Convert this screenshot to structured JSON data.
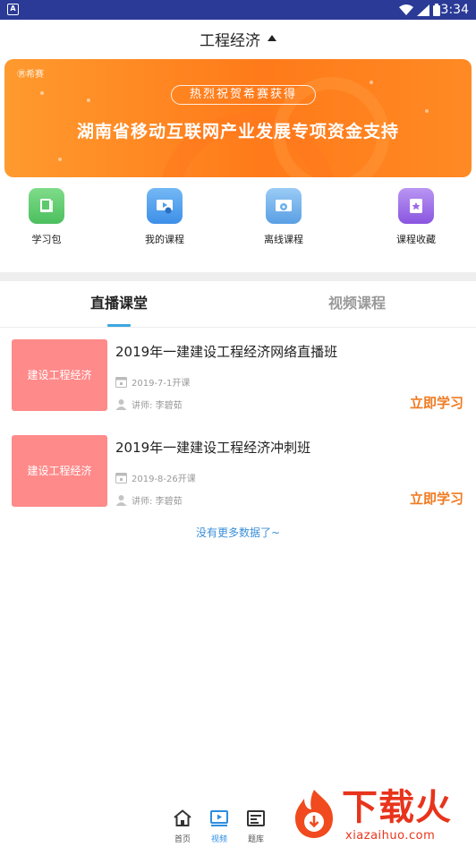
{
  "status_bar": {
    "time": "3:34",
    "app_glyph": "A"
  },
  "header": {
    "title": "工程经济"
  },
  "banner": {
    "brand": "㊚希赛",
    "pill_text": "热烈祝贺希赛获得",
    "headline": "湖南省移动互联网产业发展专项资金支持"
  },
  "quick_nav": [
    {
      "label": "学习包",
      "icon": "book-icon",
      "color": "#5cc96c"
    },
    {
      "label": "我的课程",
      "icon": "video-course-icon",
      "color": "#4a9fef"
    },
    {
      "label": "离线课程",
      "icon": "offline-disc-icon",
      "color": "#6ab0ec"
    },
    {
      "label": "课程收藏",
      "icon": "bookmark-star-icon",
      "color": "#9b6ae8"
    }
  ],
  "tabs": [
    {
      "label": "直播课堂",
      "active": true
    },
    {
      "label": "视频课程",
      "active": false
    }
  ],
  "courses": [
    {
      "thumb_text": "建设工程经济",
      "title": "2019年一建建设工程经济网络直播班",
      "date": "2019-7-1开课",
      "teacher": "讲师:  李碧茹",
      "cta": "立即学习"
    },
    {
      "thumb_text": "建设工程经济",
      "title": "2019年一建建设工程经济冲刺班",
      "date": "2019-8-26开课",
      "teacher": "讲师:  李碧茹",
      "cta": "立即学习"
    }
  ],
  "no_more": "没有更多数据了~",
  "bottom_nav": [
    {
      "label": "首页",
      "icon": "home-icon",
      "active": false
    },
    {
      "label": "视频",
      "icon": "video-icon",
      "active": true
    },
    {
      "label": "题库",
      "icon": "question-bank-icon",
      "active": false
    }
  ],
  "watermark": {
    "text": "下载火",
    "url": "xiazaihuo.com"
  },
  "colors": {
    "accent": "#3aa7e0",
    "cta": "#f07a20",
    "thumb": "#ff8a8a",
    "status_bar": "#2a3a96"
  }
}
